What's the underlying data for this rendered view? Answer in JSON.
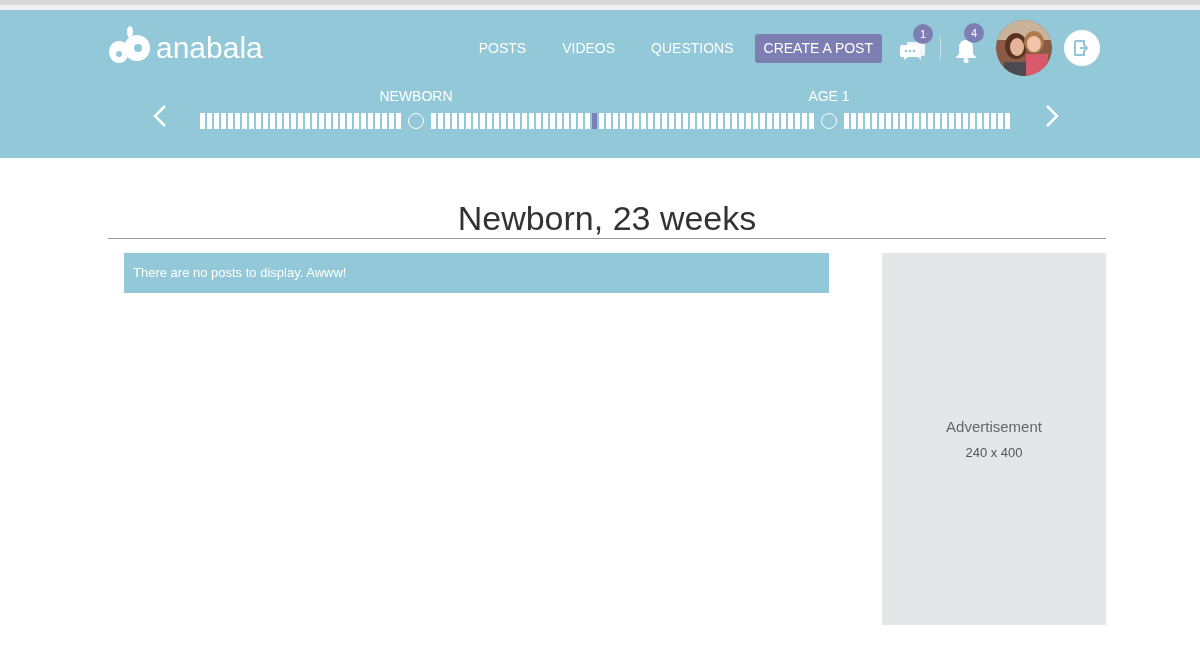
{
  "header": {
    "logo": "anabala",
    "nav": [
      {
        "label": "POSTS"
      },
      {
        "label": "VIDEOS"
      },
      {
        "label": "QUESTIONS"
      }
    ],
    "create_button": "CREATE A POST",
    "messages_badge": "1",
    "notifications_badge": "4"
  },
  "timeline": {
    "milestones": [
      {
        "label": "NEWBORN"
      },
      {
        "label": "AGE 1"
      }
    ],
    "current": {
      "level": 0.49
    }
  },
  "page_title": "Newborn, 23 weeks",
  "notice": "There are no posts to display. Awww!",
  "ad": {
    "title": "Advertisement",
    "size": "240 x 400"
  }
}
